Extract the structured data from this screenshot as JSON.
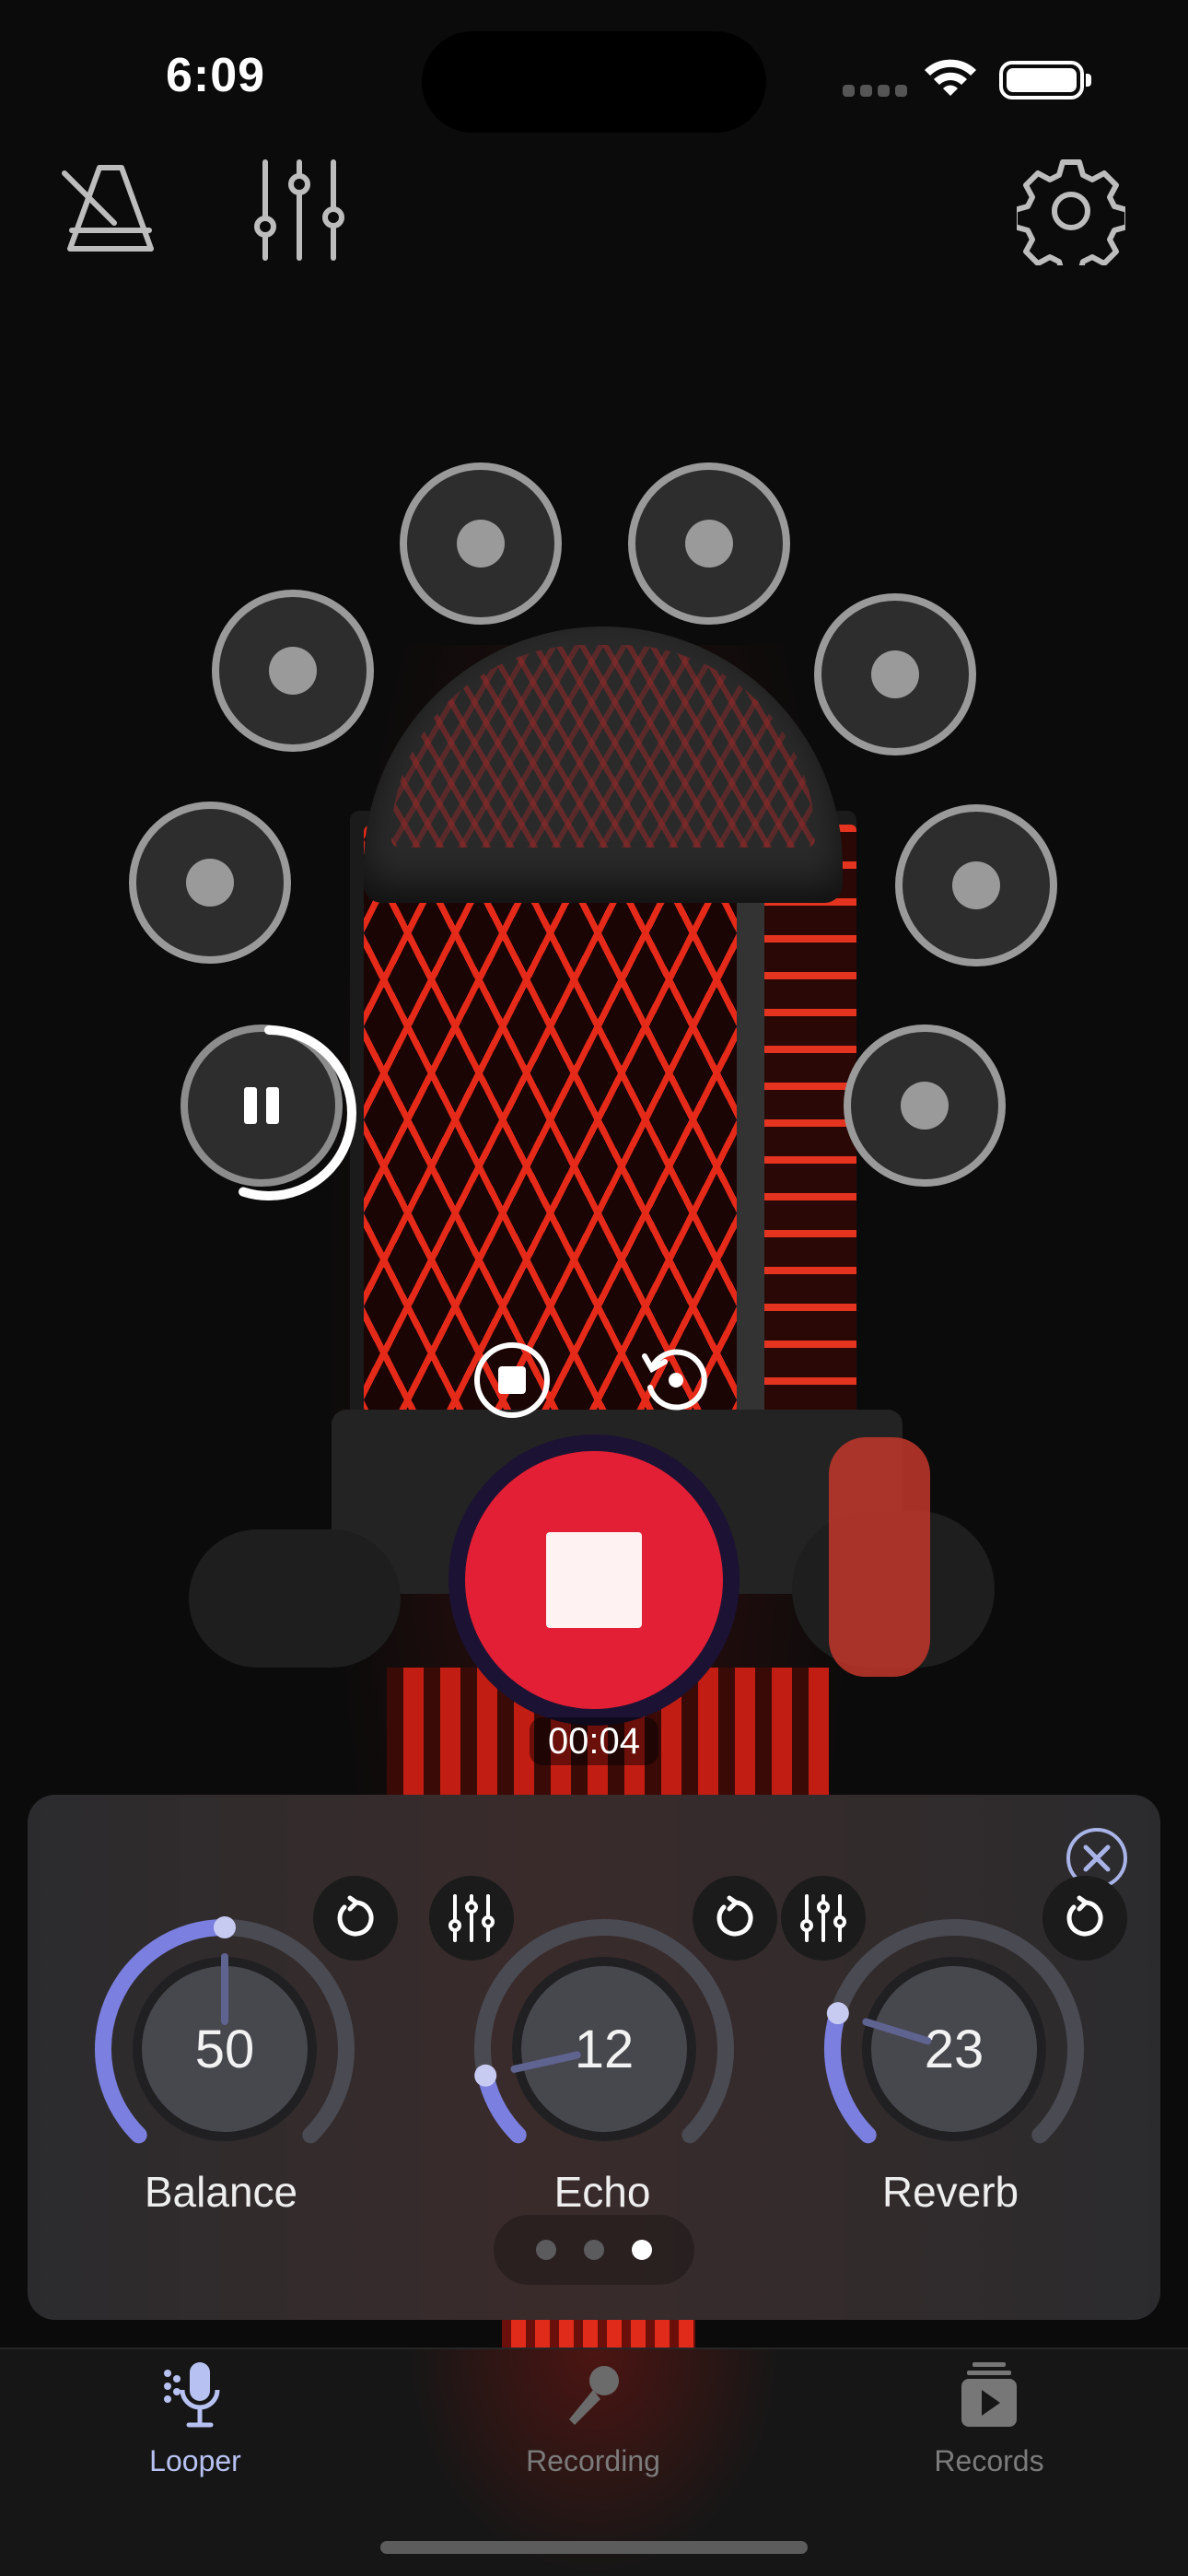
{
  "status_bar": {
    "time": "6:09"
  },
  "toolbar": {
    "metronome_icon": "metronome-icon",
    "mixer_icon": "sliders-icon",
    "settings_icon": "gear-icon"
  },
  "tracks": {
    "count": 8,
    "active_state": "paused",
    "active_progress": 0.55
  },
  "recorder": {
    "timer": "00:04",
    "accent": "#e31f35"
  },
  "effects": {
    "knobs": [
      {
        "label": "Balance",
        "value": "50",
        "fill": 0.5
      },
      {
        "label": "Echo",
        "value": "12",
        "fill": 0.12
      },
      {
        "label": "Reverb",
        "value": "23",
        "fill": 0.23
      }
    ],
    "accent": "#7b7fe0",
    "page_index": 3,
    "page_count": 3
  },
  "tabs": [
    {
      "label": "Looper",
      "icon": "mic-icon",
      "active": true
    },
    {
      "label": "Recording",
      "icon": "handheld-mic-icon",
      "active": false
    },
    {
      "label": "Records",
      "icon": "play-stack-icon",
      "active": false
    }
  ]
}
